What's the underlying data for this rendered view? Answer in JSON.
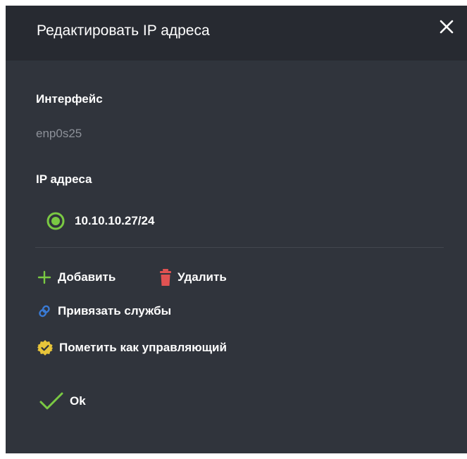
{
  "dialog": {
    "title": "Редактировать IP адреса",
    "close_icon": "close-icon"
  },
  "interface": {
    "label": "Интерфейс",
    "value": "enp0s25"
  },
  "ip_addresses": {
    "label": "IP адреса",
    "items": [
      {
        "address": "10.10.10.27/24",
        "selected": true
      }
    ]
  },
  "actions": {
    "add_label": "Добавить",
    "delete_label": "Удалить",
    "bind_services_label": "Привязать службы",
    "mark_manager_label": "Пометить как управляющий",
    "ok_label": "Ok"
  },
  "colors": {
    "background": "#30343c",
    "header": "#272a31",
    "accent_green": "#7ac943",
    "delete_red": "#e05252",
    "link_blue": "#3a7bd5",
    "badge_yellow": "#e8c53a",
    "muted_text": "#8d9199"
  },
  "icons": {
    "add": "plus-icon",
    "delete": "trash-icon",
    "bind": "link-icon",
    "mark": "badge-check-icon",
    "ok": "checkmark-icon",
    "radio": "radio-selected-icon"
  }
}
